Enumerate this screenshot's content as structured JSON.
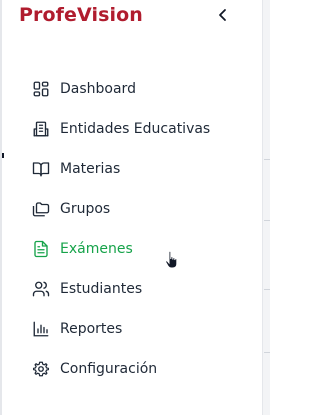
{
  "brand": {
    "name": "ProfeVision",
    "color": "#b01c2e"
  },
  "collapse_icon": "chevron-left-icon",
  "nav": {
    "active_color": "#16a34a",
    "items": [
      {
        "label": "Dashboard",
        "icon": "dashboard-grid-icon"
      },
      {
        "label": "Entidades Educativas",
        "icon": "building-icon"
      },
      {
        "label": "Materias",
        "icon": "book-open-icon"
      },
      {
        "label": "Grupos",
        "icon": "folders-icon"
      },
      {
        "label": "Exámenes",
        "icon": "file-text-icon",
        "active": true
      },
      {
        "label": "Estudiantes",
        "icon": "users-icon"
      },
      {
        "label": "Reportes",
        "icon": "bar-chart-icon"
      },
      {
        "label": "Configuración",
        "icon": "settings-gear-icon"
      }
    ]
  }
}
